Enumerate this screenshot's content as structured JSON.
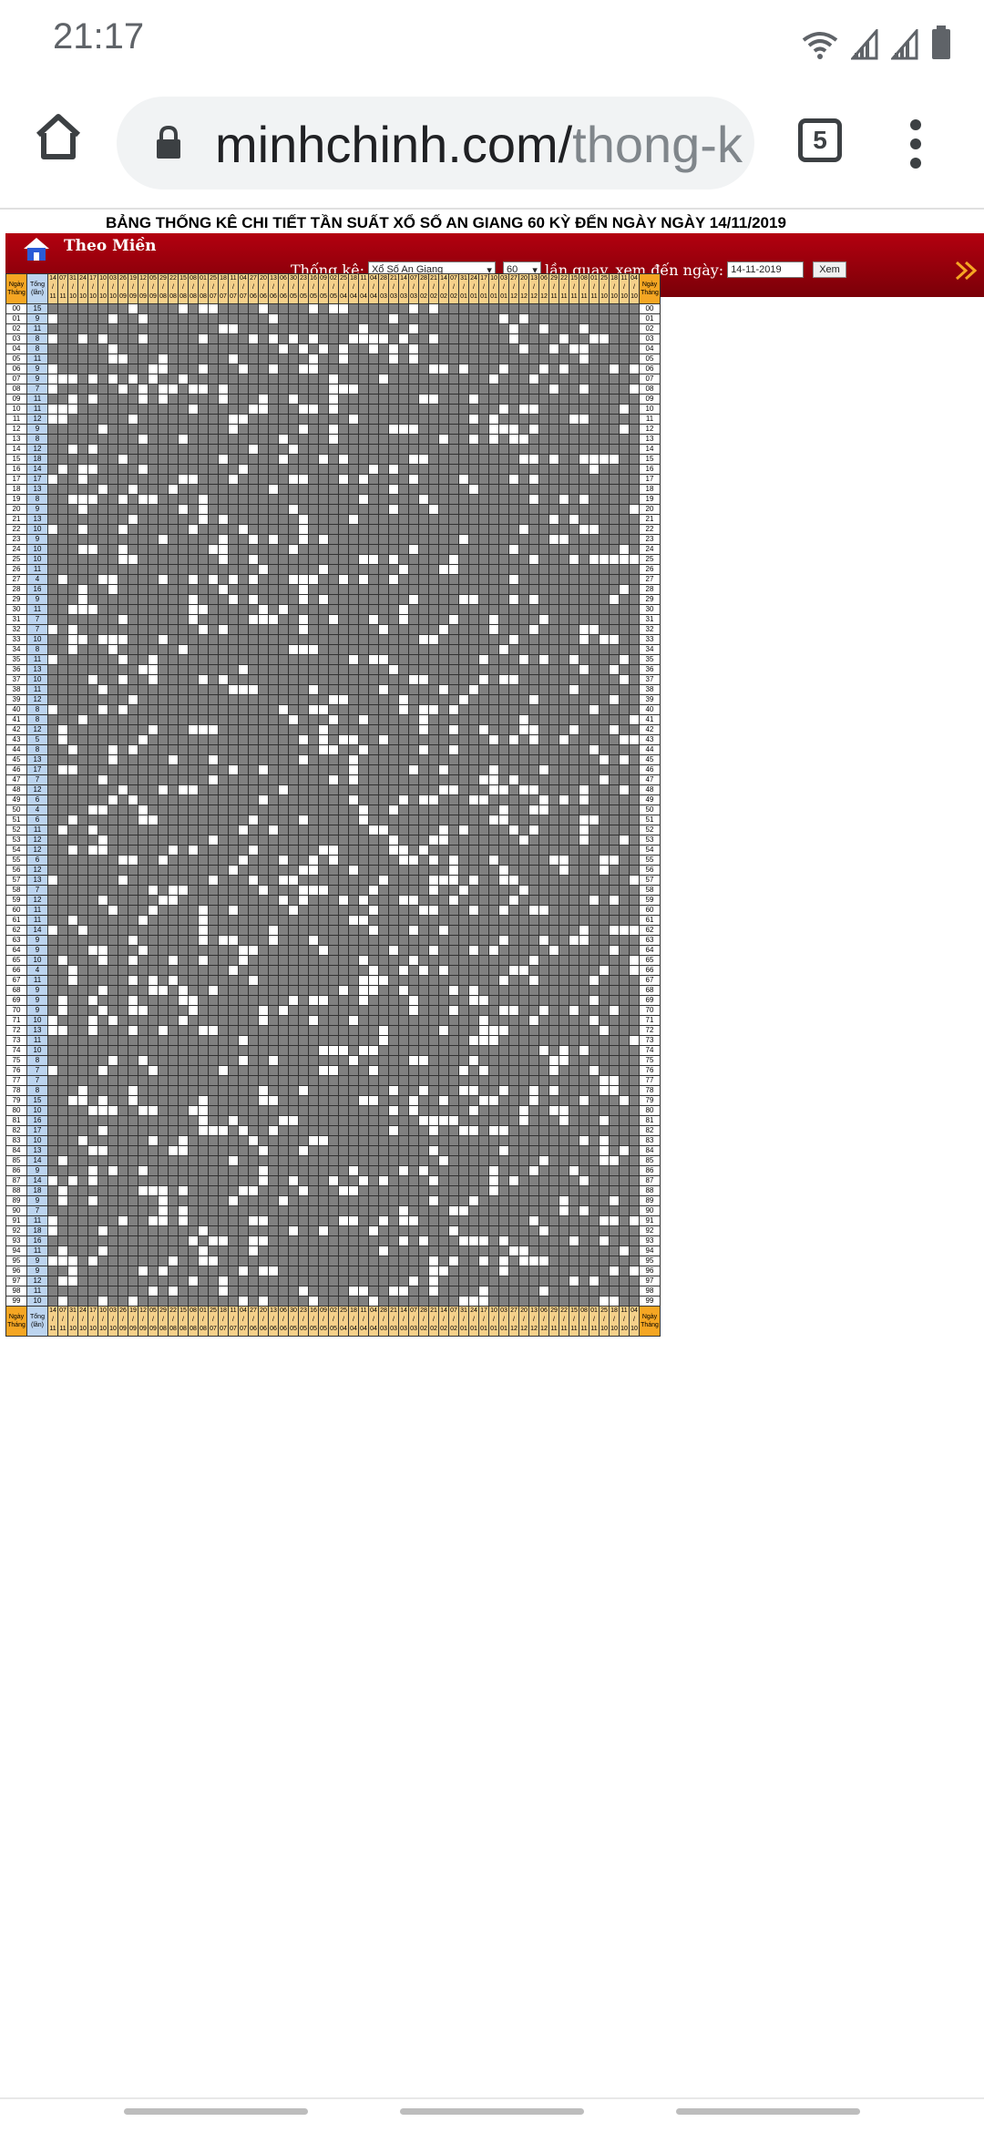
{
  "status_bar": {
    "time": "21:17"
  },
  "browser": {
    "url_main": "minhchinh.com/",
    "url_rest": "thong-k",
    "tab_count": "5"
  },
  "page": {
    "title": "BẢNG THỐNG KÊ CHI TIẾT TẦN SUẤT XỔ SỐ AN GIANG 60 KỲ ĐẾN NGÀY NGÀY 14/11/2019",
    "nav_label": "Theo Miền",
    "filter": {
      "thongke_label": "Thống kê:",
      "province": "Xổ Số An Giang",
      "count": "60",
      "lanquay_label": "lần quay, xem đến ngày:",
      "date": "14-11-2019",
      "button": "Xem"
    }
  },
  "table": {
    "corner_top": "Ngày",
    "corner_bottom": "Tháng",
    "sum_top": "Tổng",
    "sum_bottom": "(lần)",
    "day_labels": [
      "14",
      "07",
      "31",
      "24",
      "17",
      "10",
      "03",
      "26",
      "19",
      "12",
      "05",
      "29",
      "22",
      "15",
      "08",
      "01",
      "25",
      "18",
      "11",
      "04",
      "27",
      "20",
      "13",
      "06",
      "30",
      "23",
      "16",
      "09",
      "02",
      "25",
      "18",
      "11",
      "04",
      "28",
      "21",
      "14",
      "07",
      "28",
      "21",
      "14",
      "07",
      "31",
      "24",
      "17",
      "10",
      "03",
      "27",
      "20",
      "13",
      "06",
      "29",
      "22",
      "15",
      "08",
      "01",
      "25",
      "18",
      "11",
      "04"
    ],
    "month_labels": [
      "11",
      "11",
      "10",
      "10",
      "10",
      "10",
      "10",
      "09",
      "09",
      "09",
      "09",
      "08",
      "08",
      "08",
      "08",
      "08",
      "07",
      "07",
      "07",
      "07",
      "06",
      "06",
      "06",
      "06",
      "05",
      "05",
      "05",
      "05",
      "05",
      "04",
      "04",
      "04",
      "04",
      "03",
      "03",
      "03",
      "03",
      "02",
      "02",
      "02",
      "02",
      "01",
      "01",
      "01",
      "01",
      "01",
      "12",
      "12",
      "12",
      "12",
      "11",
      "11",
      "11",
      "11",
      "11",
      "10",
      "10",
      "10",
      "10"
    ],
    "numbers": [
      "00",
      "01",
      "02",
      "03",
      "04",
      "05",
      "06",
      "07",
      "08",
      "09",
      "10",
      "11",
      "12",
      "13",
      "14",
      "15",
      "16",
      "17",
      "18",
      "19",
      "20",
      "21",
      "22",
      "23",
      "24",
      "25",
      "26",
      "27",
      "28",
      "29",
      "30",
      "31",
      "32",
      "33",
      "34",
      "35",
      "36",
      "37",
      "38",
      "39",
      "40",
      "41",
      "42",
      "43",
      "44",
      "45",
      "46",
      "47",
      "48",
      "49",
      "50",
      "51",
      "52",
      "53",
      "54",
      "55",
      "56",
      "57",
      "58",
      "59",
      "60",
      "61",
      "62",
      "63",
      "64",
      "65",
      "66",
      "67",
      "68",
      "69",
      "70",
      "71",
      "72",
      "73",
      "74",
      "75",
      "76",
      "77",
      "78",
      "79",
      "80",
      "81",
      "82",
      "83",
      "84",
      "85",
      "86",
      "87",
      "88",
      "89",
      "90",
      "91",
      "92",
      "93",
      "94",
      "95",
      "96",
      "97",
      "98",
      "99"
    ],
    "totals": [
      "15",
      "9",
      "11",
      "8",
      "8",
      "11",
      "9",
      "9",
      "7",
      "11",
      "11",
      "12",
      "9",
      "8",
      "12",
      "18",
      "14",
      "17",
      "13",
      "8",
      "9",
      "13",
      "10",
      "9",
      "10",
      "10",
      "11",
      "4",
      "16",
      "9",
      "11",
      "7",
      "7",
      "10",
      "8",
      "11",
      "13",
      "10",
      "11",
      "12",
      "8",
      "8",
      "12",
      "5",
      "8",
      "13",
      "17",
      "7",
      "12",
      "6",
      "4",
      "6",
      "11",
      "12",
      "12",
      "6",
      "12",
      "13",
      "7",
      "12",
      "11",
      "11",
      "14",
      "9",
      "9",
      "10",
      "4",
      "11",
      "9",
      "9",
      "9",
      "10",
      "13",
      "11",
      "10",
      "8",
      "7",
      "7",
      "8",
      "15",
      "10",
      "16",
      "17",
      "10",
      "13",
      "14",
      "9",
      "14",
      "18",
      "9",
      "7",
      "11",
      "18",
      "16",
      "11",
      "9",
      "9",
      "12",
      "11",
      "10"
    ]
  },
  "colors": {
    "header_red": "#b3000f",
    "grid_gray": "#808080",
    "day_header": "#f5d08a",
    "sum_blue": "#bcd4ef"
  }
}
